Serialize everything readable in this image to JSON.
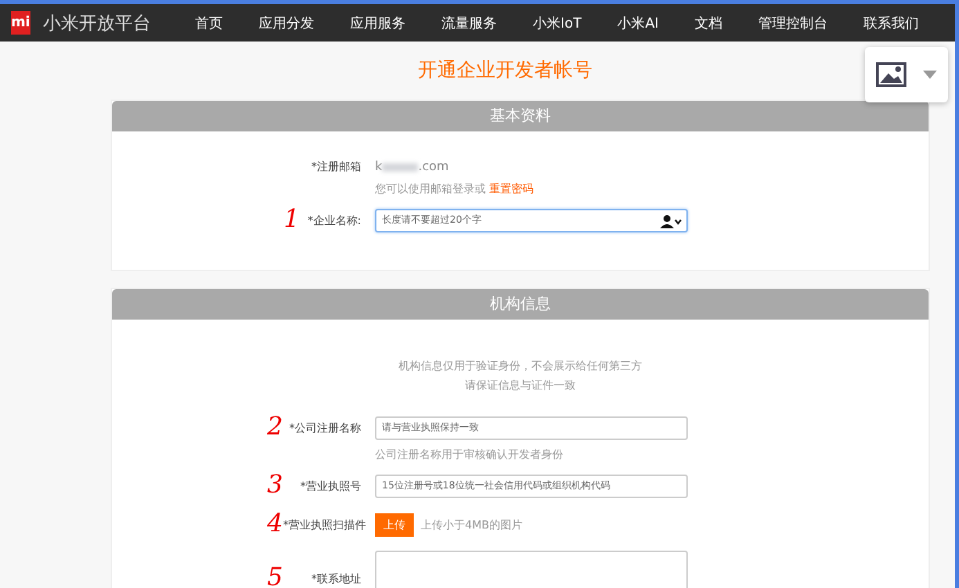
{
  "navbar": {
    "brand_mark": "mi",
    "brand": "小米开放平台",
    "items": [
      {
        "label": "首页"
      },
      {
        "label": "应用分发"
      },
      {
        "label": "应用服务"
      },
      {
        "label": "流量服务"
      },
      {
        "label": "小米IoT"
      },
      {
        "label": "小米AI"
      },
      {
        "label": "文档"
      },
      {
        "label": "管理控制台"
      },
      {
        "label": "联系我们"
      }
    ]
  },
  "page_title": "开通企业开发者帐号",
  "basic_section": {
    "title": "基本资料",
    "email_label": "*注册邮箱",
    "email_start": "k",
    "email_end": ".com",
    "email_hint": "您可以使用邮箱登录或",
    "reset_link": "重置密码",
    "company_label": "*企业名称:",
    "company_placeholder": "长度请不要超过20个字",
    "annotation": "1"
  },
  "org_section": {
    "title": "机构信息",
    "notice": [
      "机构信息仅用于验证身份，不会展示给任何第三方",
      "请保证信息与证件一致"
    ],
    "fields": [
      {
        "kind": "text",
        "annotation": "2",
        "label": "*公司注册名称",
        "placeholder": "请与营业执照保持一致",
        "hint": "公司注册名称用于审核确认开发者身份"
      },
      {
        "kind": "text",
        "annotation": "3",
        "label": "*营业执照号",
        "placeholder": "15位注册号或18位统一社会信用代码或组织机构代码"
      },
      {
        "kind": "upload",
        "annotation": "4",
        "label": "*营业执照扫描件",
        "button": "上传",
        "hint": "上传小于4MB的图片"
      },
      {
        "kind": "textarea",
        "annotation": "5",
        "label": "*联系地址"
      }
    ]
  }
}
